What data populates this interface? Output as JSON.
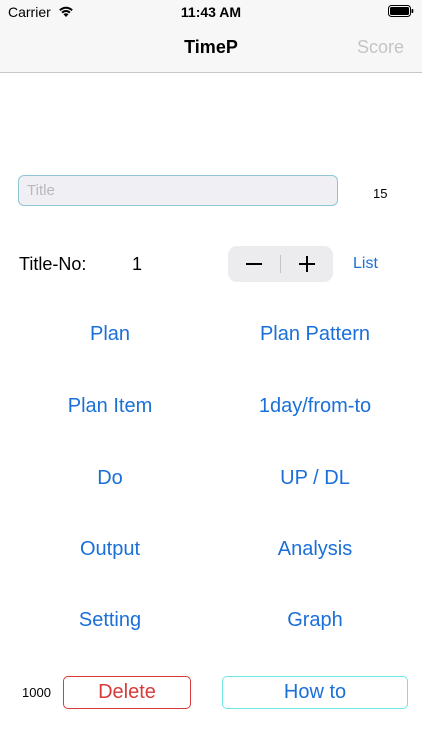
{
  "status_bar": {
    "carrier": "Carrier",
    "time": "11:43 AM",
    "wifi_icon": "wifi-icon",
    "battery_icon": "battery-icon"
  },
  "nav": {
    "title": "TimeP",
    "score_label": "Score"
  },
  "title_field": {
    "placeholder": "Title",
    "value": "",
    "max_length_display": "15"
  },
  "title_no": {
    "label": "Title-No:",
    "value": "1",
    "minus": "−",
    "plus": "+",
    "list_label": "List"
  },
  "menu": {
    "plan": "Plan",
    "plan_pattern": "Plan Pattern",
    "plan_item": "Plan Item",
    "one_day": "1day/from-to",
    "do": "Do",
    "up_dl": "UP / DL",
    "output": "Output",
    "analysis": "Analysis",
    "setting": "Setting",
    "graph": "Graph"
  },
  "bottom": {
    "count": "1000",
    "delete_label": "Delete",
    "howto_label": "How to"
  },
  "colors": {
    "accent": "#1a6fd8",
    "delete": "#d93a3a",
    "howto_border": "#6fe6e6",
    "score_disabled": "#c4c4c8"
  }
}
